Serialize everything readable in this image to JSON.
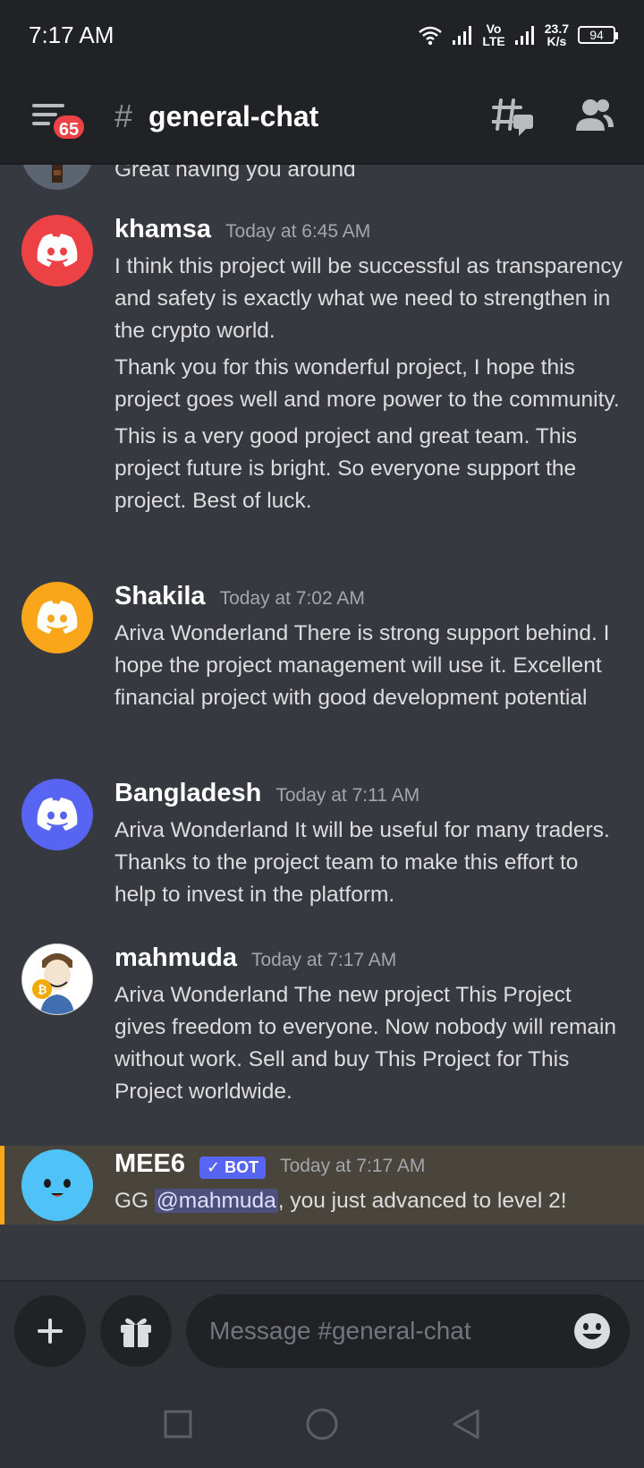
{
  "status_bar": {
    "time": "7:17 AM",
    "network_top": "Vo",
    "network_bottom": "LTE",
    "speed_value": "23.7",
    "speed_unit": "K/s",
    "battery": "94"
  },
  "header": {
    "unread_badge": "65",
    "channel_hash": "#",
    "channel_name": "general-chat",
    "icons": [
      "menu-icon",
      "threads-icon",
      "members-icon"
    ]
  },
  "messages": [
    {
      "continuation_text": "Great having you around"
    },
    {
      "author": "khamsa",
      "timestamp": "Today at 6:45 AM",
      "avatar_color": "#ed4245",
      "paragraphs": [
        "I think this project will be successful as transparency and safety is exactly what we need to strengthen in the crypto world.",
        "Thank you for this wonderful project, I hope this project goes well and more power to the community.",
        "This is a very good project and great team. This project future is bright. So everyone support the project. Best of luck."
      ]
    },
    {
      "author": "Shakila",
      "timestamp": "Today at 7:02 AM",
      "avatar_color": "#faa61a",
      "paragraphs": [
        "Ariva Wonderland There is strong support behind.  I hope the project management will use it.  Excellent financial project with good development potential"
      ]
    },
    {
      "author": "Bangladesh",
      "timestamp": "Today at 7:11 AM",
      "avatar_color": "#5865f2",
      "paragraphs": [
        "Ariva Wonderland It will be useful for many traders. Thanks to the project team to make this effort to help to invest in the platform."
      ]
    },
    {
      "author": "mahmuda",
      "timestamp": "Today at 7:17 AM",
      "paragraphs": [
        "Ariva Wonderland The new project This Project gives freedom to everyone. Now nobody will remain without work. Sell and buy This Project for This Project worldwide."
      ]
    },
    {
      "author": "MEE6",
      "bot_tag": "✓ BOT",
      "timestamp": "Today at 7:17 AM",
      "text_before": "GG ",
      "mention": "@mahmuda",
      "text_after": ", you just advanced to level 2!",
      "avatar_color": "#4fc3f7",
      "highlight_color": "#faa61a"
    }
  ],
  "composer": {
    "placeholder": "Message #general-chat",
    "icons": [
      "plus-icon",
      "gift-icon",
      "emoji-icon"
    ]
  },
  "navbar": {
    "icons": [
      "recents-icon",
      "home-icon",
      "back-icon"
    ]
  }
}
